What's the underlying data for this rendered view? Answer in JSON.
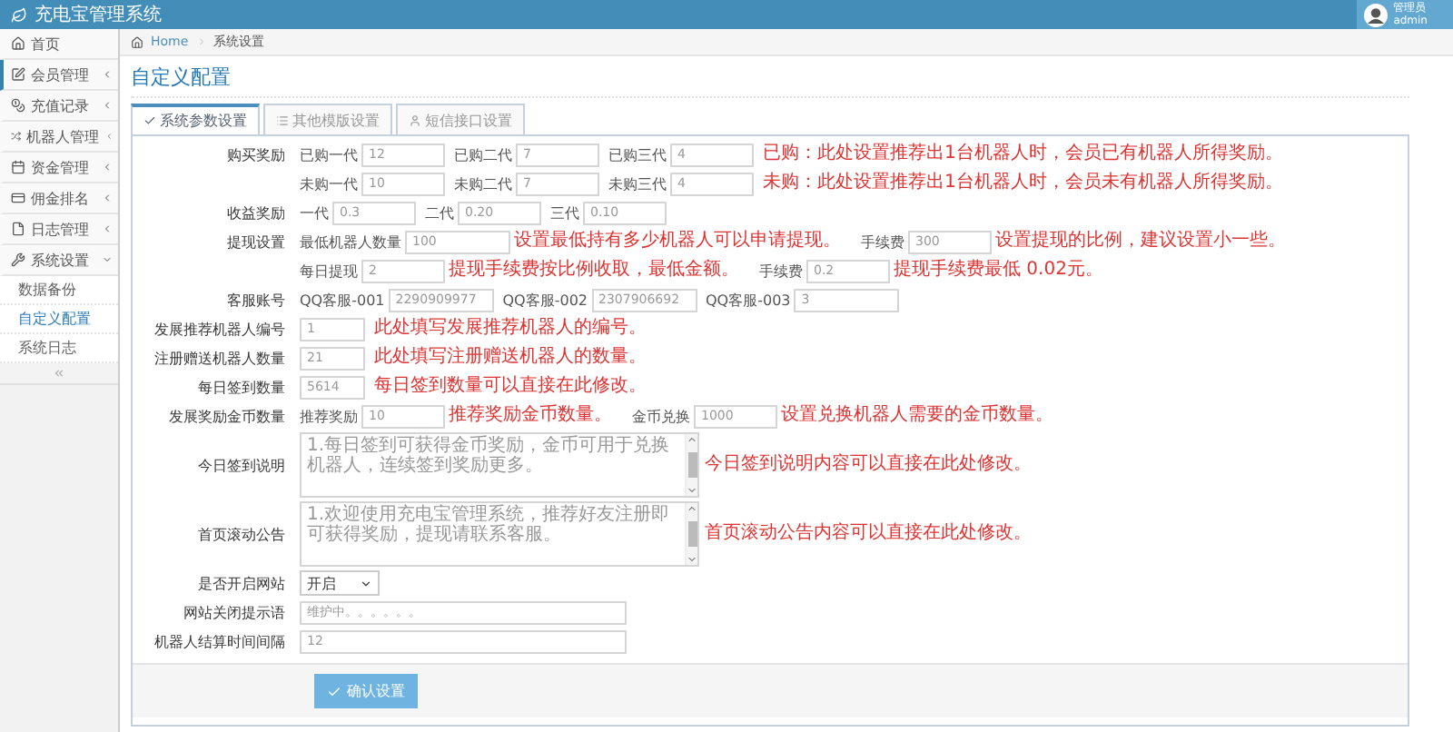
{
  "header": {
    "title": "充电宝管理系统",
    "user_name": "管理员",
    "user_role": "admin"
  },
  "sidebar": {
    "items": [
      {
        "kind": "link",
        "label": "首页",
        "selected": false
      },
      {
        "kind": "group",
        "label": "会员管理",
        "selected": true,
        "expanded": false
      },
      {
        "kind": "group",
        "label": "充值记录",
        "selected": false,
        "expanded": false
      },
      {
        "kind": "group",
        "label": "机器人管理",
        "selected": false,
        "expanded": false
      },
      {
        "kind": "group",
        "label": "资金管理",
        "selected": false,
        "expanded": false
      },
      {
        "kind": "group",
        "label": "佣金排名",
        "selected": false,
        "expanded": false
      },
      {
        "kind": "group",
        "label": "日志管理",
        "selected": false,
        "expanded": false
      },
      {
        "kind": "group",
        "label": "系统设置",
        "selected": false,
        "expanded": true,
        "children": [
          {
            "label": "数据备份",
            "selected": false
          },
          {
            "label": "自定义配置",
            "selected": true
          },
          {
            "label": "系统日志",
            "selected": false
          }
        ]
      }
    ]
  },
  "breadcrumb": [
    {
      "label": "Home"
    },
    {
      "label": "系统设置"
    }
  ],
  "page_title": "自定义配置",
  "tabs": [
    {
      "label": "系统参数设置",
      "selected": true
    },
    {
      "label": "其他模版设置",
      "selected": false
    },
    {
      "label": "短信接口设置",
      "selected": false
    }
  ],
  "form": {
    "rows": [
      {
        "kind": "inputs",
        "label": "购买奖励",
        "fields": [
          {
            "prefix": "已购一代",
            "value": "12"
          },
          {
            "prefix": "已购二代",
            "value": "7"
          },
          {
            "prefix": "已购三代",
            "value": "4"
          }
        ],
        "note": "已购：此处设置推荐出1台机器人时，会员已有机器人所得奖励。"
      },
      {
        "kind": "inputs",
        "fields": [
          {
            "prefix": "未购一代",
            "value": "10"
          },
          {
            "prefix": "未购二代",
            "value": "7"
          },
          {
            "prefix": "未购三代",
            "value": "4"
          }
        ],
        "note": "未购：此处设置推荐出1台机器人时，会员未有机器人所得奖励。"
      },
      {
        "kind": "inputs",
        "label": "收益奖励",
        "fields": [
          {
            "prefix": "一代",
            "value": "0.3"
          },
          {
            "prefix": "二代",
            "value": "0.20"
          },
          {
            "prefix": "三代",
            "value": "0.10"
          }
        ]
      },
      {
        "kind": "inputs",
        "label": "提现设置",
        "fields": [
          {
            "prefix": "最低机器人数量",
            "value": "100",
            "note": "设置最低持有多少机器人可以申请提现。"
          },
          {
            "prefix": "手续费",
            "value": "300",
            "note": "设置提现的比例，建议设置小一些。"
          }
        ]
      },
      {
        "kind": "inputs",
        "fields": [
          {
            "prefix": "每日提现",
            "value": "2",
            "note": "提现手续费按比例收取，最低金额。"
          },
          {
            "prefix": "手续费",
            "value": "0.2",
            "note": "提现手续费最低 0.02元。"
          }
        ]
      },
      {
        "kind": "inputs",
        "label": "客服账号",
        "fields": [
          {
            "prefix": "QQ客服-001",
            "value": "2290909977"
          },
          {
            "prefix": "QQ客服-002",
            "value": "2307906692"
          },
          {
            "prefix": "QQ客服-003",
            "value": "3"
          }
        ]
      },
      {
        "kind": "inputs",
        "label": "发展推荐机器人编号",
        "fields": [
          {
            "value": "1"
          }
        ],
        "note": "此处填写发展推荐机器人的编号。"
      },
      {
        "kind": "inputs",
        "label": "注册赠送机器人数量",
        "fields": [
          {
            "value": "21"
          }
        ],
        "note": "此处填写注册赠送机器人的数量。"
      },
      {
        "kind": "inputs",
        "label": "每日签到数量",
        "fields": [
          {
            "value": "5614"
          }
        ],
        "note": "每日签到数量可以直接在此修改。"
      },
      {
        "kind": "inputs",
        "label": "发展奖励金币数量",
        "fields": [
          {
            "prefix": "推荐奖励",
            "value": "10",
            "note": "推荐奖励金币数量。"
          },
          {
            "prefix": "金币兑换",
            "value": "1000",
            "note": "设置兑换机器人需要的金币数量。"
          }
        ]
      },
      {
        "kind": "textarea",
        "label": "今日签到说明",
        "value": "1.每日签到可获得金币奖励，金币可用于兑换机器人，连续签到奖励更多。",
        "note": "今日签到说明内容可以直接在此处修改。"
      },
      {
        "kind": "textarea",
        "label": "首页滚动公告",
        "value": "1.欢迎使用充电宝管理系统，推荐好友注册即可获得奖励，提现请联系客服。",
        "note": "首页滚动公告内容可以直接在此处修改。"
      },
      {
        "kind": "select",
        "label": "是否开启网站",
        "value": "开启"
      },
      {
        "kind": "text",
        "label": "网站关闭提示语",
        "value": "维护中。。。。。。"
      },
      {
        "kind": "text",
        "label": "机器人结算时间间隔",
        "value": "12"
      }
    ]
  },
  "submit": {
    "label": "确认设置"
  }
}
